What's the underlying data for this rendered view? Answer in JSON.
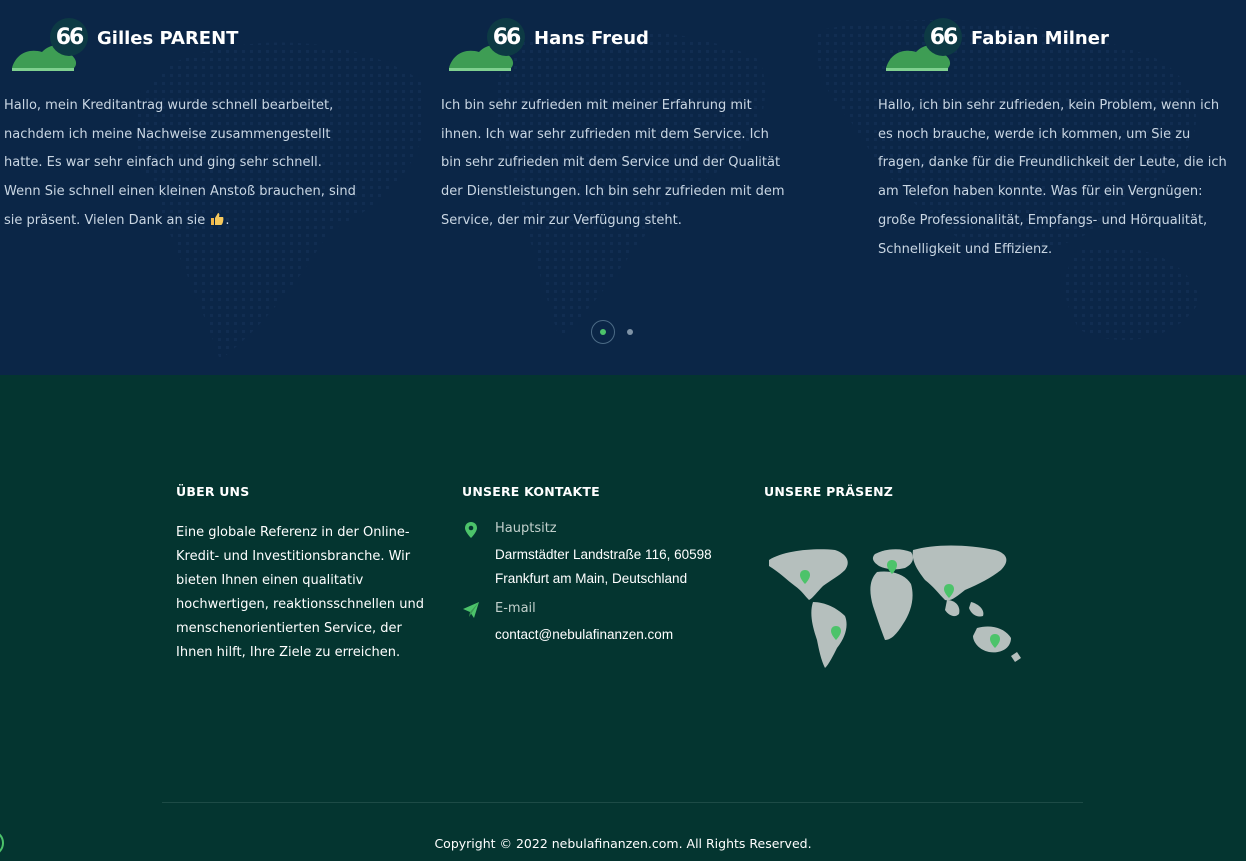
{
  "testimonials": [
    {
      "name": "Gilles PARENT",
      "text_before_emoji": "Hallo, mein Kreditantrag wurde schnell bearbeitet, nachdem ich meine Nachweise zusammengestellt hatte. Es war sehr einfach und ging sehr schnell. Wenn Sie schnell einen kleinen Anstoß brauchen, sind sie präsent. Vielen Dank an sie",
      "emoji": "thumbs-up-icon",
      "text_after_emoji": "."
    },
    {
      "name": "Hans Freud",
      "text": "Ich bin sehr zufrieden mit meiner Erfahrung mit ihnen. Ich war sehr zufrieden mit dem Service. Ich bin sehr zufrieden mit dem Service und der Qualität der Dienstleistungen. Ich bin sehr zufrieden mit dem Service, der mir zur Verfügung steht."
    },
    {
      "name": "Fabian Milner",
      "text": "Hallo, ich bin sehr zufrieden, kein Problem, wenn ich es noch brauche, werde ich kommen, um Sie zu fragen, danke für die Freundlichkeit der Leute, die ich am Telefon haben konnte. Was für ein Vergnügen: große Professionalität, Empfangs- und Hörqualität, Schnelligkeit und Effizienz."
    }
  ],
  "quote_glyph": "66",
  "pager": {
    "pages": 2,
    "active": 1
  },
  "footer": {
    "about": {
      "title": "ÜBER UNS",
      "text": "Eine globale Referenz in der Online-Kredit- und Investitionsbranche. Wir bieten Ihnen einen qualitativ hochwertigen, reaktionsschnellen und menschenorientierten Service, der Ihnen hilft, Ihre Ziele zu erreichen."
    },
    "contacts": {
      "title": "UNSERE KONTAKTE",
      "hq_label": "Hauptsitz",
      "hq_line1": "Darmstädter Landstraße 116, 60598",
      "hq_line2": "Frankfurt am Main, Deutschland",
      "email_label": "E-mail",
      "email": "contact@nebulafinanzen.com"
    },
    "presence": {
      "title": "UNSERE PRÄSENZ"
    },
    "copyright": "Copyright © 2022 nebulafinanzen.com. All Rights Reserved."
  },
  "colors": {
    "testimonial_bg": "#0b2647",
    "footer_bg": "#043530",
    "accent_green": "#4cc36a",
    "map_gray": "#b5bfbd"
  }
}
